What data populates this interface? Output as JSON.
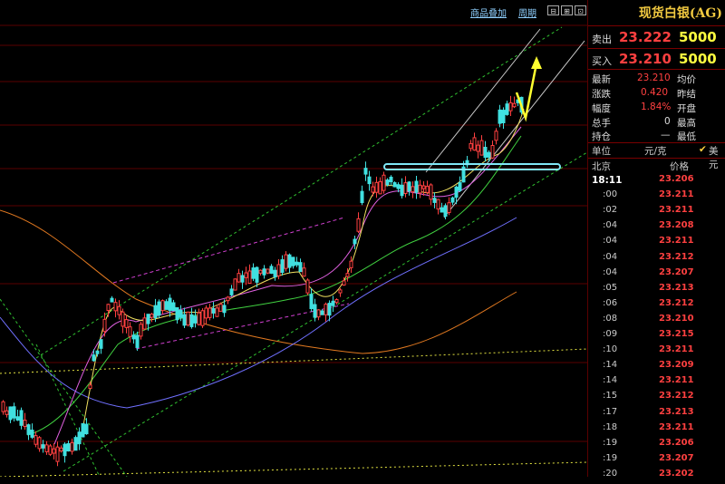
{
  "toolbar": {
    "overlay_label": "商品叠加",
    "period_label": "周期"
  },
  "instrument": {
    "title": "现货白银(AG)"
  },
  "quote": {
    "sell_label": "卖出",
    "sell_price": "23.222",
    "sell_volume": "5000",
    "buy_label": "买入",
    "buy_price": "23.210",
    "buy_volume": "5000"
  },
  "stats": {
    "latest_label": "最新",
    "latest_value": "23.210",
    "change_label": "涨跌",
    "change_value": "0.420",
    "range_label": "幅度",
    "range_value": "1.84%",
    "total_label": "总手",
    "total_value": "0",
    "hold_label": "持仓",
    "hold_value": "—",
    "avg_label": "均价",
    "prevclose_label": "昨结",
    "open_label": "开盘",
    "high_label": "最高",
    "low_label": "最低"
  },
  "unit": {
    "label": "单位",
    "value": "元/克",
    "usd_label": "美元"
  },
  "ticks_header": {
    "zone_label": "北京",
    "price_label": "价格",
    "current_time": "18:11"
  },
  "ticks": [
    {
      "time": "",
      "price": "23.206"
    },
    {
      "time": ":00",
      "price": "23.211"
    },
    {
      "time": ":02",
      "price": "23.211"
    },
    {
      "time": ":04",
      "price": "23.208"
    },
    {
      "time": ":04",
      "price": "23.211"
    },
    {
      "time": ":04",
      "price": "23.212"
    },
    {
      "time": ":04",
      "price": "23.207"
    },
    {
      "time": ":05",
      "price": "23.213"
    },
    {
      "time": ":06",
      "price": "23.212"
    },
    {
      "time": ":08",
      "price": "23.210"
    },
    {
      "time": ":09",
      "price": "23.215"
    },
    {
      "time": ":10",
      "price": "23.211"
    },
    {
      "time": ":14",
      "price": "23.209"
    },
    {
      "time": ":14",
      "price": "23.211"
    },
    {
      "time": ":15",
      "price": "23.212"
    },
    {
      "time": ":17",
      "price": "23.213"
    },
    {
      "time": ":18",
      "price": "23.211"
    },
    {
      "time": ":19",
      "price": "23.206"
    },
    {
      "time": ":19",
      "price": "23.207"
    },
    {
      "time": ":20",
      "price": "23.202"
    }
  ],
  "colors": {
    "up": "#ff4040",
    "down": "#40e0e0",
    "ma_fast": "#f0e060",
    "ma_mid": "#e060e0",
    "ma_slow": "#40d040",
    "ma_long": "#7070ff",
    "ma_very_long": "#e07820"
  }
}
